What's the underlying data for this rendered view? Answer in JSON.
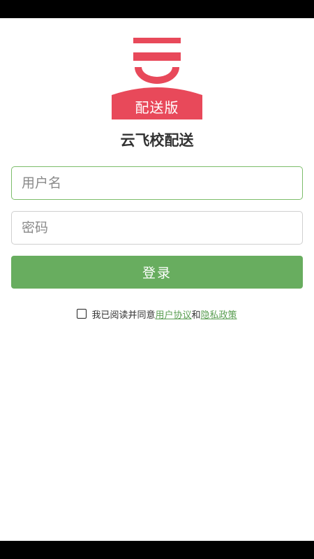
{
  "logo": {
    "badge_text": "配送版",
    "brand_color": "#e8495a"
  },
  "app_title": "云飞校配送",
  "form": {
    "username_placeholder": "用户名",
    "password_placeholder": "密码",
    "login_label": "登录"
  },
  "agreement": {
    "checked": false,
    "prefix": "我已阅读并同意",
    "user_agreement": "用户协议",
    "and": "和",
    "privacy_policy": "隐私政策"
  },
  "colors": {
    "primary_green": "#68ad5f",
    "link_green": "#5a9e52",
    "active_border": "#7cbd6a"
  }
}
